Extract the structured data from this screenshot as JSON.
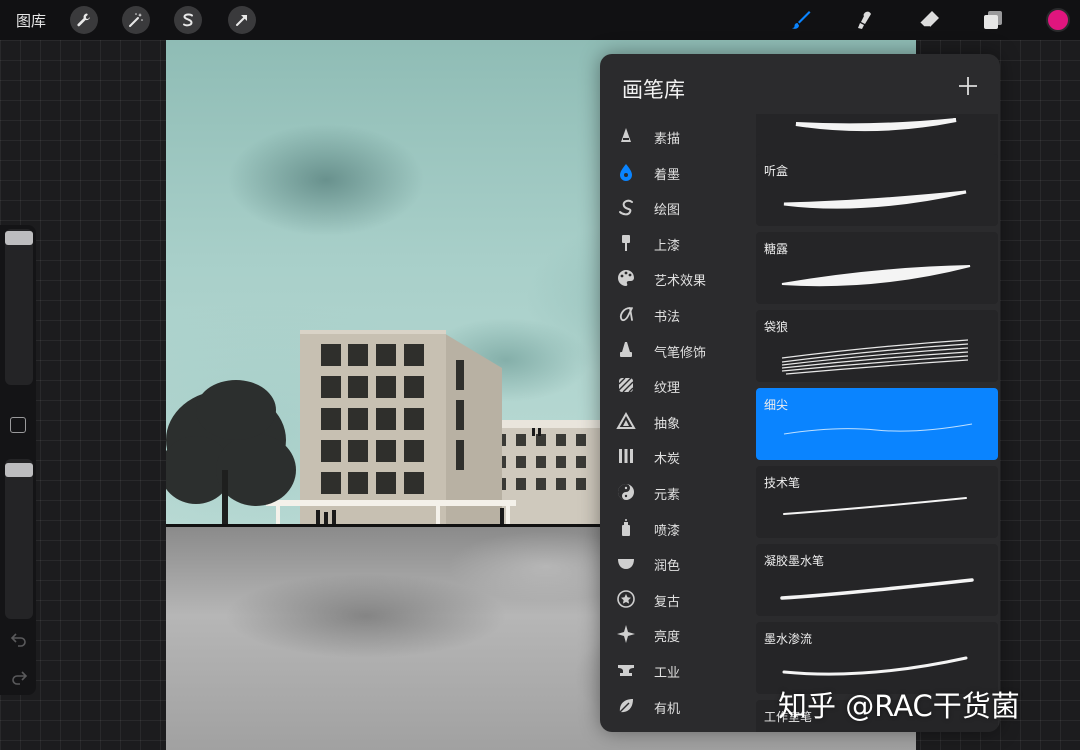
{
  "topbar": {
    "gallery_label": "图库",
    "left_tools": [
      "wrench-icon",
      "magic-wand-icon",
      "selection-s-icon",
      "transform-arrow-icon"
    ],
    "right_tools": [
      "brush-icon",
      "smudge-icon",
      "eraser-icon",
      "layers-icon"
    ],
    "active_tool": "brush-icon",
    "active_color": "#e0157e",
    "accent_color": "#0a84ff"
  },
  "panel": {
    "title": "画笔库",
    "add_icon": "plus-icon",
    "selected_category": "着墨",
    "categories": [
      {
        "label": "素描",
        "icon": "pencil-tip-icon"
      },
      {
        "label": "着墨",
        "icon": "ink-drop-icon"
      },
      {
        "label": "绘图",
        "icon": "squiggle-icon"
      },
      {
        "label": "上漆",
        "icon": "paint-brush-icon"
      },
      {
        "label": "艺术效果",
        "icon": "palette-icon"
      },
      {
        "label": "书法",
        "icon": "calligraphy-icon"
      },
      {
        "label": "气笔修饰",
        "icon": "airbrush-icon"
      },
      {
        "label": "纹理",
        "icon": "texture-icon"
      },
      {
        "label": "抽象",
        "icon": "triangle-icon"
      },
      {
        "label": "木炭",
        "icon": "charcoal-icon"
      },
      {
        "label": "元素",
        "icon": "yin-yang-icon"
      },
      {
        "label": "喷漆",
        "icon": "spray-can-icon"
      },
      {
        "label": "润色",
        "icon": "bowl-icon"
      },
      {
        "label": "复古",
        "icon": "star-badge-icon"
      },
      {
        "label": "亮度",
        "icon": "sparkle-icon"
      },
      {
        "label": "工业",
        "icon": "anvil-icon"
      },
      {
        "label": "有机",
        "icon": "leaf-icon"
      }
    ],
    "brushes": [
      {
        "name": "",
        "selected": false
      },
      {
        "name": "听盒",
        "selected": false
      },
      {
        "name": "糖露",
        "selected": false
      },
      {
        "name": "袋狼",
        "selected": false
      },
      {
        "name": "细尖",
        "selected": true
      },
      {
        "name": "技术笔",
        "selected": false
      },
      {
        "name": "凝胶墨水笔",
        "selected": false
      },
      {
        "name": "墨水渗流",
        "selected": false
      },
      {
        "name": "工作室笔",
        "selected": false
      }
    ]
  },
  "watermark": "知乎 @RAC干货菌"
}
